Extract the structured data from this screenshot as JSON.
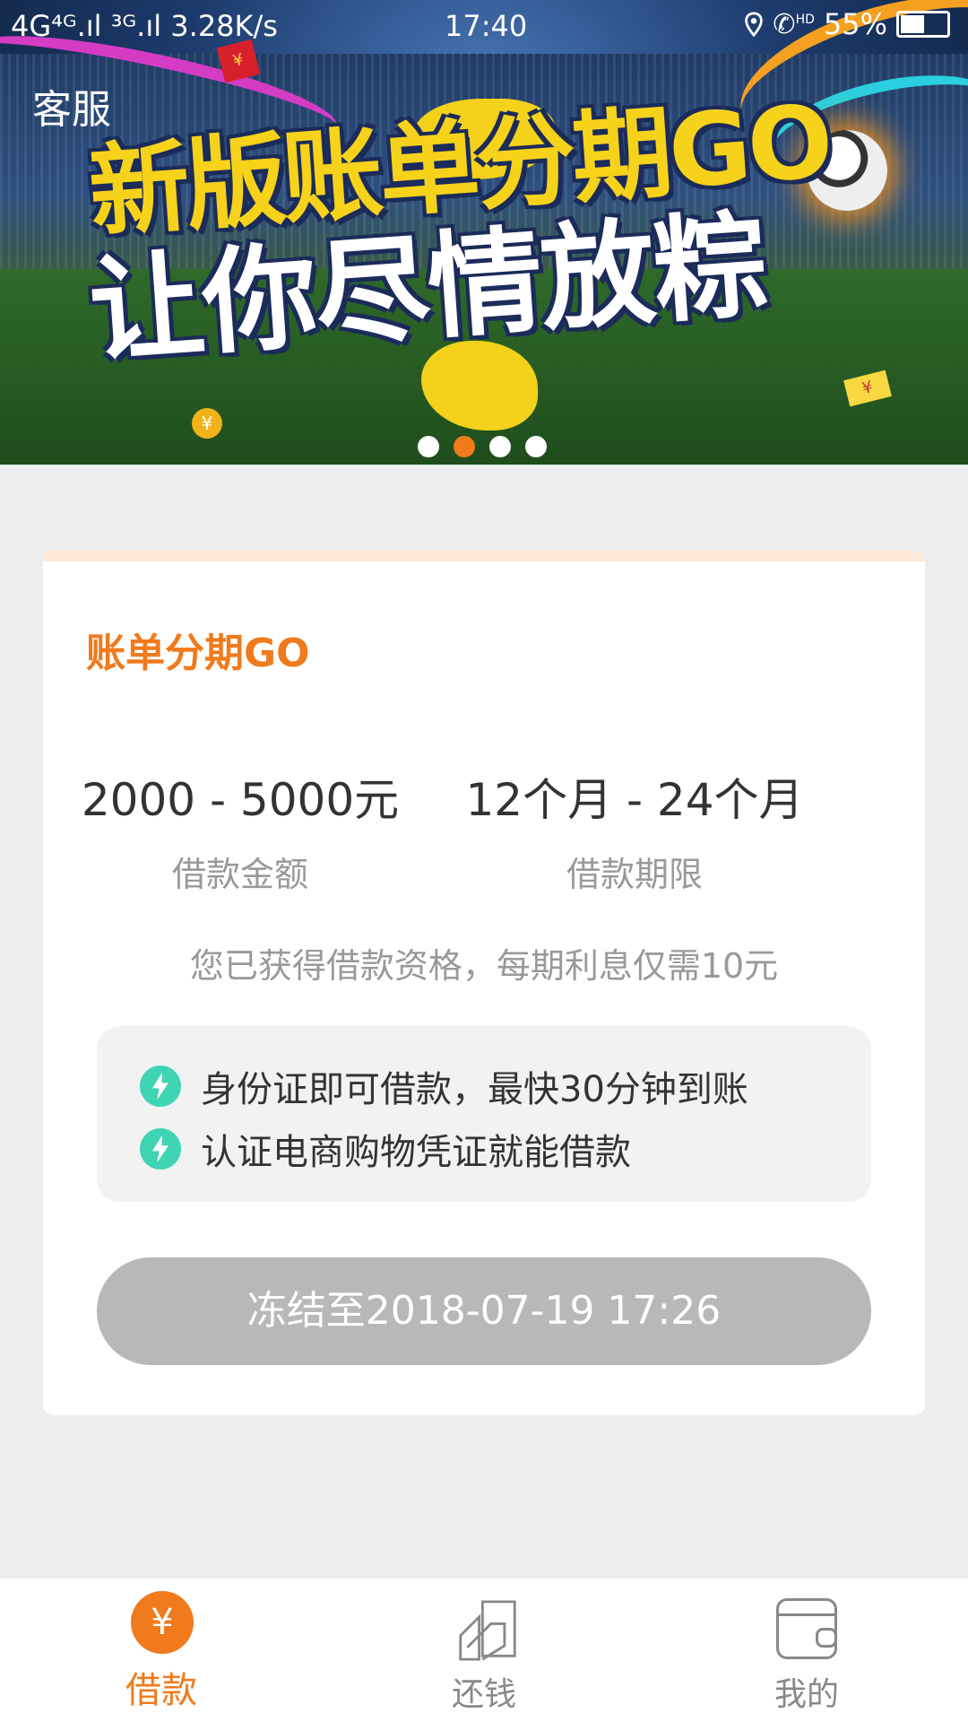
{
  "status_bar": {
    "signal": "4G⁴ᴳ.ıl ³ᴳ.ıl 3.28K/s",
    "time": "17:40",
    "hd": "HD",
    "battery": "55%"
  },
  "banner": {
    "service_link": "客服",
    "headline_line1": "新版账单分期GO",
    "headline_line2": "让你尽情放粽",
    "carousel_dots": 4,
    "active_dot_index": 1
  },
  "card": {
    "title": "账单分期GO",
    "amount_range": "2000 - 5000元",
    "amount_label": "借款金额",
    "term_range": "12个月 - 24个月",
    "term_label": "借款期限",
    "eligibility": "您已获得借款资格，每期利息仅需10元",
    "features": [
      "身份证即可借款，最快30分钟到账",
      "认证电商购物凭证就能借款"
    ],
    "action_button": "冻结至2018-07-19 17:26"
  },
  "tabbar": {
    "tabs": [
      {
        "label": "借款",
        "icon": "yen-icon",
        "active": true
      },
      {
        "label": "还钱",
        "icon": "repay-icon",
        "active": false
      },
      {
        "label": "我的",
        "icon": "wallet-icon",
        "active": false
      }
    ]
  },
  "colors": {
    "accent": "#f07a1c",
    "feature_icon": "#3fd4b4",
    "disabled_button": "#b8b8b8"
  }
}
